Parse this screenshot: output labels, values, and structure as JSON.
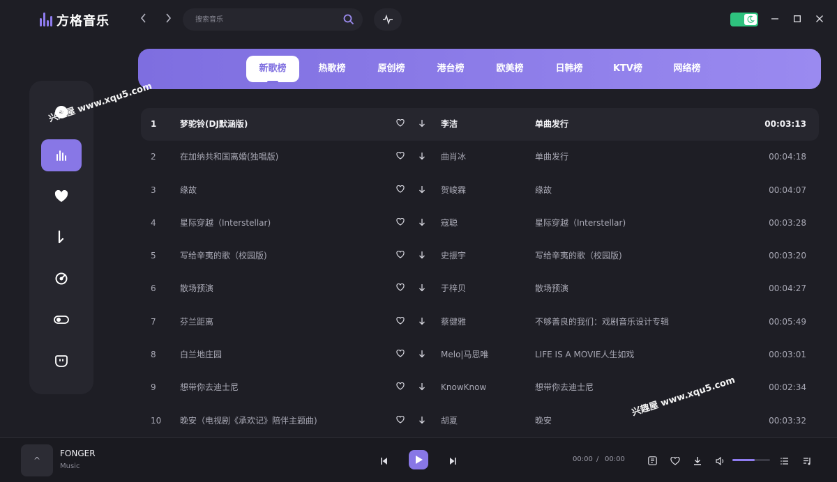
{
  "app": {
    "name": "方格音乐"
  },
  "search": {
    "placeholder": "搜索音乐"
  },
  "tabs": [
    {
      "label": "新歌榜",
      "active": true
    },
    {
      "label": "热歌榜",
      "active": false
    },
    {
      "label": "原创榜",
      "active": false
    },
    {
      "label": "港台榜",
      "active": false
    },
    {
      "label": "欧美榜",
      "active": false
    },
    {
      "label": "日韩榜",
      "active": false
    },
    {
      "label": "KTV榜",
      "active": false
    },
    {
      "label": "网络榜",
      "active": false
    }
  ],
  "sidebar": {
    "items": [
      {
        "icon": "disc-icon",
        "active": false
      },
      {
        "icon": "equalizer-icon",
        "active": true
      },
      {
        "icon": "heart-icon",
        "active": false
      },
      {
        "icon": "music-note-icon",
        "active": false
      },
      {
        "icon": "target-icon",
        "active": false
      },
      {
        "icon": "toggle-icon",
        "active": false
      },
      {
        "icon": "face-icon",
        "active": false
      }
    ]
  },
  "songs": [
    {
      "rank": "1",
      "title": "梦驼铃(DJ默涵版)",
      "artist": "李洁",
      "album": "单曲发行",
      "duration": "00:03:13"
    },
    {
      "rank": "2",
      "title": "在加纳共和国离婚(独唱版)",
      "artist": "曲肖冰",
      "album": "单曲发行",
      "duration": "00:04:18"
    },
    {
      "rank": "3",
      "title": "缘故",
      "artist": "贺峻霖",
      "album": "缘故",
      "duration": "00:04:07"
    },
    {
      "rank": "4",
      "title": "星际穿越（Interstellar)",
      "artist": "寇聪",
      "album": "星际穿越（Interstellar)",
      "duration": "00:03:28"
    },
    {
      "rank": "5",
      "title": "写给辛夷的歌（校园版)",
      "artist": "史振宇",
      "album": "写给辛夷的歌（校园版)",
      "duration": "00:03:20"
    },
    {
      "rank": "6",
      "title": "散场预演",
      "artist": "于梓贝",
      "album": "散场预演",
      "duration": "00:04:27"
    },
    {
      "rank": "7",
      "title": "芬兰距离",
      "artist": "蔡健雅",
      "album": "不够善良的我们：戏剧音乐设计专辑",
      "duration": "00:05:49"
    },
    {
      "rank": "8",
      "title": "白兰地庄园",
      "artist": "Melo|马思唯",
      "album": "LIFE IS A MOVIE人生如戏",
      "duration": "00:03:01"
    },
    {
      "rank": "9",
      "title": "想带你去迪士尼",
      "artist": "KnowKnow",
      "album": "想带你去迪士尼",
      "duration": "00:02:34"
    },
    {
      "rank": "10",
      "title": "晚安（电视剧《承欢记》陪伴主题曲)",
      "artist": "胡夏",
      "album": "晚安",
      "duration": "00:03:32"
    }
  ],
  "watermarks": [
    {
      "text": "兴趣屋 www.xqu5.com"
    },
    {
      "text": "兴趣屋 www.xqu5.com"
    }
  ],
  "player": {
    "cover_label": "^",
    "track_name": "FONGER",
    "track_sub": "Music",
    "current_time": "00:00",
    "separator": "/",
    "total_time": "00:00",
    "volume": 0.6
  },
  "colors": {
    "accent": "#8877e6",
    "background": "#1e1e25",
    "toggle": "#2ec27e"
  }
}
